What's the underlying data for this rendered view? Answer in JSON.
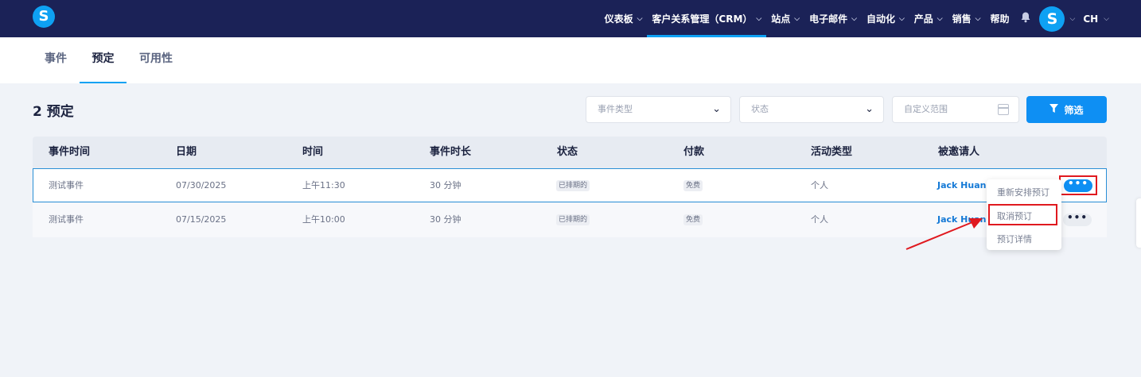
{
  "nav": {
    "logo": "S",
    "items": [
      {
        "label": "仪表板",
        "chevron": true
      },
      {
        "label": "客户关系管理（CRM）",
        "chevron": true,
        "active": true
      },
      {
        "label": "站点",
        "chevron": true
      },
      {
        "label": "电子邮件",
        "chevron": true
      },
      {
        "label": "自动化",
        "chevron": true
      },
      {
        "label": "产品",
        "chevron": true
      },
      {
        "label": "销售",
        "chevron": true
      },
      {
        "label": "帮助",
        "chevron": false
      }
    ],
    "avatar_letter": "S",
    "language": "CH"
  },
  "tabs": [
    {
      "label": "事件"
    },
    {
      "label": "预定",
      "active": true
    },
    {
      "label": "可用性"
    }
  ],
  "page": {
    "title": "2 预定",
    "event_type_placeholder": "事件类型",
    "status_placeholder": "状态",
    "date_range_placeholder": "自定义范围",
    "filter_label": "筛选"
  },
  "table": {
    "headers": [
      "事件时间",
      "日期",
      "时间",
      "事件时长",
      "状态",
      "付款",
      "活动类型",
      "被邀请人"
    ],
    "rows": [
      {
        "event": "测试事件",
        "date": "07/30/2025",
        "time": "上午11:30",
        "duration": "30 分钟",
        "status": "已排期的",
        "payment": "免费",
        "type": "个人",
        "invitee": "Jack Huang"
      },
      {
        "event": "测试事件",
        "date": "07/15/2025",
        "time": "上午10:00",
        "duration": "30 分钟",
        "status": "已排期的",
        "payment": "免费",
        "type": "个人",
        "invitee": "Jack Huang"
      }
    ]
  },
  "menu": {
    "items": [
      {
        "label": "重新安排预订"
      },
      {
        "label": "取消预订",
        "highlighted": true
      },
      {
        "label": "预订详情"
      }
    ]
  },
  "colors": {
    "nav_bg": "#1b2257",
    "accent": "#0e8ff3",
    "highlight": "#e0191f"
  }
}
